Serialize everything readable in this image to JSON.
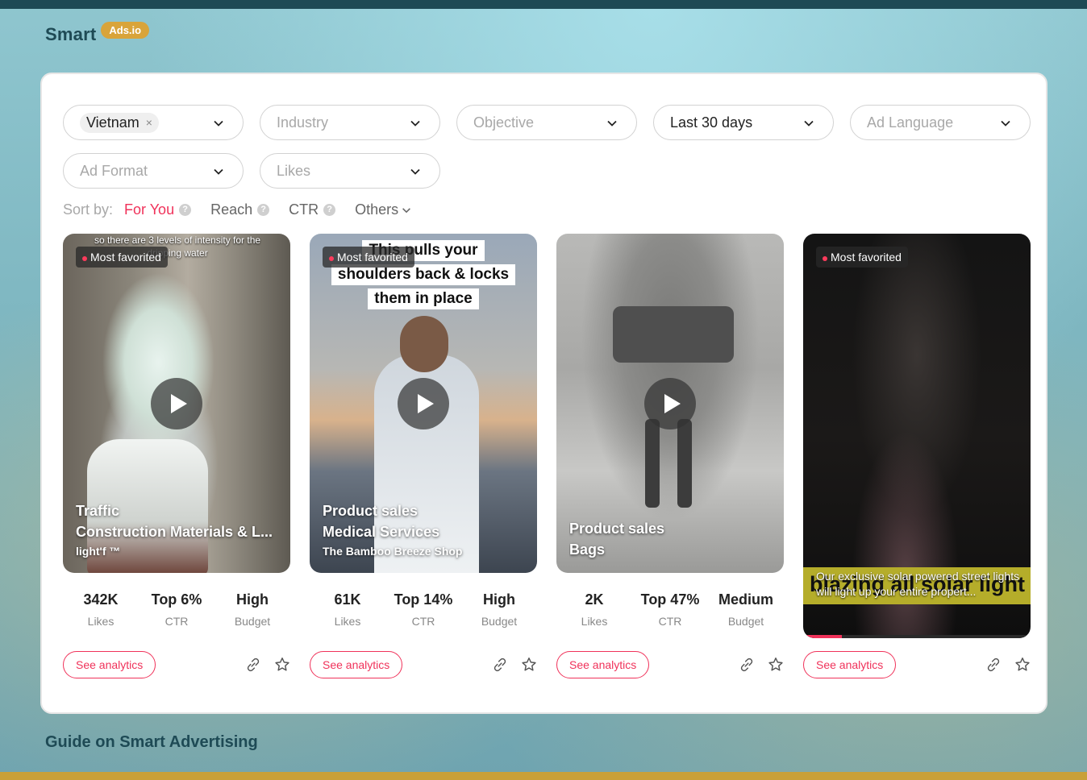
{
  "brand": {
    "name": "Smart",
    "badge": "Ads.io"
  },
  "footer": {
    "guide": "Guide on Smart Advertising"
  },
  "filters": {
    "country": {
      "chip": "Vietnam",
      "remove": "×"
    },
    "industry": {
      "placeholder": "Industry"
    },
    "objective": {
      "placeholder": "Objective"
    },
    "period": {
      "value": "Last 30 days"
    },
    "language": {
      "placeholder": "Ad Language"
    },
    "format": {
      "placeholder": "Ad Format"
    },
    "likes": {
      "placeholder": "Likes"
    }
  },
  "sort": {
    "label": "Sort by:",
    "options": [
      {
        "label": "For You",
        "help": "?"
      },
      {
        "label": "Reach",
        "help": "?"
      },
      {
        "label": "CTR",
        "help": "?"
      },
      {
        "label": "Others"
      }
    ]
  },
  "cards": [
    {
      "badge": "Most favorited",
      "overlay": "so there are 3 levels of intensity for the dripping water",
      "objective": "Traffic",
      "industry": "Construction Materials & L...",
      "brand": "light'f ™",
      "stats": [
        {
          "value": "342K",
          "label": "Likes"
        },
        {
          "value": "Top 6%",
          "label": "CTR"
        },
        {
          "value": "High",
          "label": "Budget"
        }
      ],
      "button": "See analytics"
    },
    {
      "badge": "Most favorited",
      "overlay_lines": [
        "This pulls your",
        "shoulders back & locks",
        "them in place"
      ],
      "objective": "Product sales",
      "industry": "Medical Services",
      "brand": "The Bamboo Breeze Shop",
      "stats": [
        {
          "value": "61K",
          "label": "Likes"
        },
        {
          "value": "Top 14%",
          "label": "CTR"
        },
        {
          "value": "High",
          "label": "Budget"
        }
      ],
      "button": "See analytics"
    },
    {
      "objective": "Product sales",
      "industry": "Bags",
      "stats": [
        {
          "value": "2K",
          "label": "Likes"
        },
        {
          "value": "Top 47%",
          "label": "CTR"
        },
        {
          "value": "Medium",
          "label": "Budget"
        }
      ],
      "button": "See analytics"
    },
    {
      "badge": "Most favorited",
      "overlay_big": "blazing all solar light",
      "overlay_small": "Our exclusive solar powered street lights will light up your entire propert...",
      "progress": 0.17,
      "button": "See analytics"
    }
  ],
  "colors": {
    "accent": "#f0325a",
    "brand": "#1e4a55",
    "badge": "#d9a43a"
  }
}
